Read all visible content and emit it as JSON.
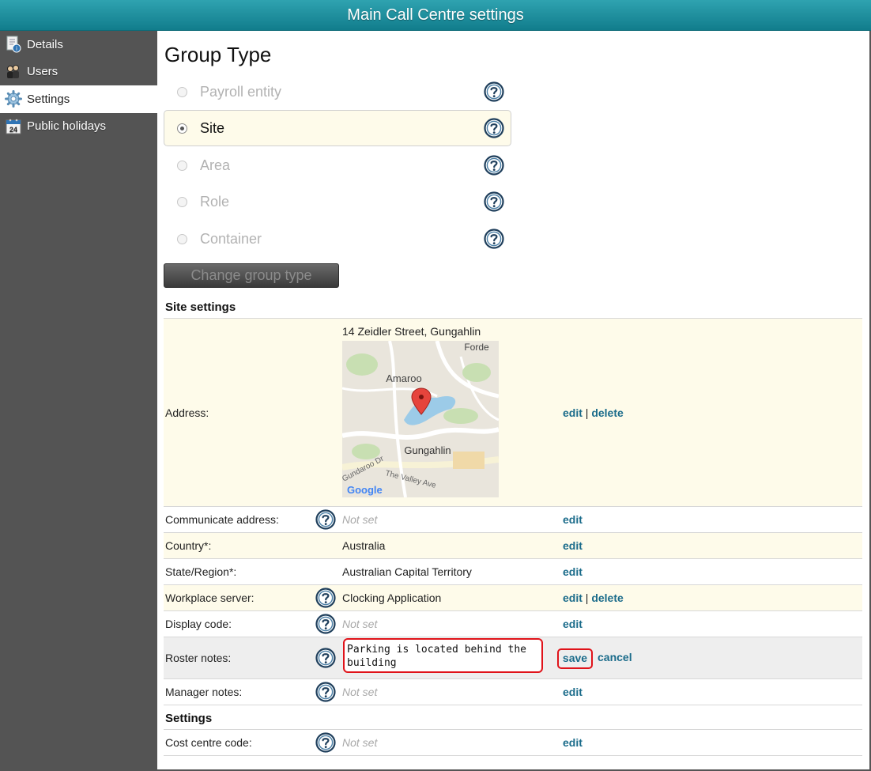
{
  "window": {
    "title": "Main Call Centre settings"
  },
  "sidebar": {
    "items": [
      {
        "label": "Details",
        "icon": "details-icon"
      },
      {
        "label": "Users",
        "icon": "users-icon"
      },
      {
        "label": "Settings",
        "icon": "gear-icon",
        "active": true
      },
      {
        "label": "Public holidays",
        "icon": "calendar-icon",
        "icon_text": "24"
      }
    ]
  },
  "group_type": {
    "heading": "Group Type",
    "options": [
      {
        "label": "Payroll entity",
        "selected": false
      },
      {
        "label": "Site",
        "selected": true
      },
      {
        "label": "Area",
        "selected": false
      },
      {
        "label": "Role",
        "selected": false
      },
      {
        "label": "Container",
        "selected": false
      }
    ],
    "change_button": "Change group type"
  },
  "site_settings": {
    "title": "Site settings",
    "address": {
      "label": "Address:",
      "value": "14 Zeidler Street, Gungahlin",
      "map_labels": [
        "Forde",
        "Amaroo",
        "Gungahlin",
        "Gundaroo Dr",
        "The Valley Ave"
      ],
      "map_logo": "Google",
      "edit": "edit",
      "separator": "|",
      "delete": "delete"
    },
    "rows": [
      {
        "label": "Communicate address:",
        "value": "Not set",
        "edit": "edit"
      },
      {
        "label": "Country*:",
        "value": "Australia",
        "edit": "edit"
      },
      {
        "label": "State/Region*:",
        "value": "Australian Capital Territory",
        "edit": "edit"
      },
      {
        "label": "Workplace server:",
        "value": "Clocking Application",
        "edit": "edit",
        "separator": "|",
        "delete": "delete"
      },
      {
        "label": "Display code:",
        "value": "Not set",
        "edit": "edit"
      }
    ],
    "roster_notes": {
      "label": "Roster notes:",
      "value": "Parking is located behind the building",
      "save": "save",
      "cancel": "cancel"
    },
    "manager_notes": {
      "label": "Manager notes:",
      "value": "Not set",
      "edit": "edit"
    }
  },
  "settings": {
    "title": "Settings",
    "cost_centre": {
      "label": "Cost centre code:",
      "value": "Not set",
      "edit": "edit"
    }
  },
  "colors": {
    "title_bar": "#1a8c9b",
    "sidebar": "#545454",
    "link": "#1a6b8a",
    "highlight_row": "#fefbea",
    "focus_outline": "#e0131a"
  }
}
